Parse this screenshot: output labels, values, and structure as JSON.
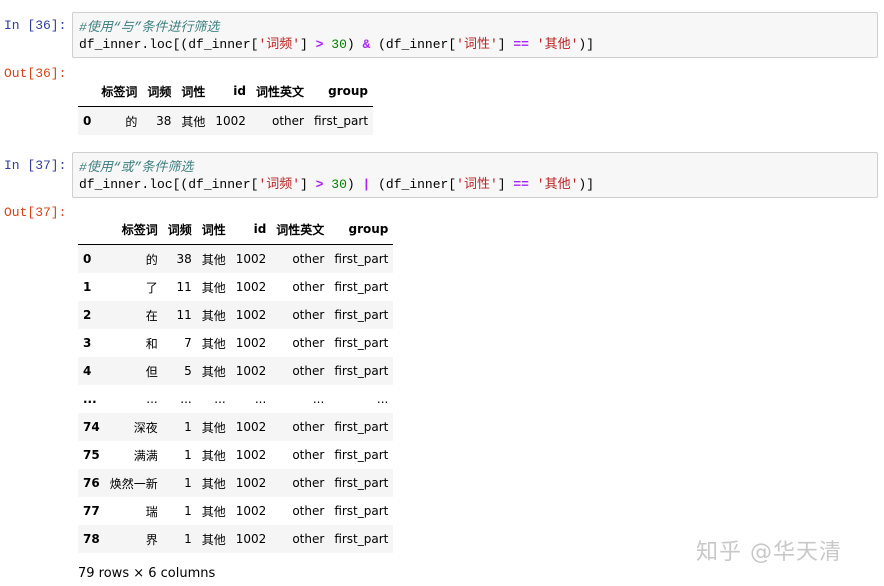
{
  "cells": [
    {
      "in_prompt": "In  [36]:",
      "out_prompt": "Out[36]:",
      "comment": "#使用“与”条件进行筛选",
      "code_parts": [
        "df_inner.loc[(df_inner[",
        "'词频'",
        "] ",
        ">",
        " ",
        "30",
        ") ",
        "&",
        " (df_inner[",
        "'词性'",
        "] ",
        "==",
        " ",
        "'其他'",
        ")]"
      ],
      "table": {
        "columns": [
          "",
          "标签词",
          "词频",
          "词性",
          "id",
          "词性英文",
          "group"
        ],
        "rows": [
          [
            "0",
            "的",
            "38",
            "其他",
            "1002",
            "other",
            "first_part"
          ]
        ]
      }
    },
    {
      "in_prompt": "In  [37]:",
      "out_prompt": "Out[37]:",
      "comment": "#使用“或”条件筛选",
      "code_parts": [
        "df_inner.loc[(df_inner[",
        "'词频'",
        "] ",
        ">",
        " ",
        "30",
        ") ",
        "|",
        " (df_inner[",
        "'词性'",
        "] ",
        "==",
        " ",
        "'其他'",
        ")]"
      ],
      "table": {
        "columns": [
          "",
          "标签词",
          "词频",
          "词性",
          "id",
          "词性英文",
          "group"
        ],
        "rows": [
          [
            "0",
            "的",
            "38",
            "其他",
            "1002",
            "other",
            "first_part"
          ],
          [
            "1",
            "了",
            "11",
            "其他",
            "1002",
            "other",
            "first_part"
          ],
          [
            "2",
            "在",
            "11",
            "其他",
            "1002",
            "other",
            "first_part"
          ],
          [
            "3",
            "和",
            "7",
            "其他",
            "1002",
            "other",
            "first_part"
          ],
          [
            "4",
            "但",
            "5",
            "其他",
            "1002",
            "other",
            "first_part"
          ],
          [
            "...",
            "...",
            "...",
            "...",
            "...",
            "...",
            "..."
          ],
          [
            "74",
            "深夜",
            "1",
            "其他",
            "1002",
            "other",
            "first_part"
          ],
          [
            "75",
            "满满",
            "1",
            "其他",
            "1002",
            "other",
            "first_part"
          ],
          [
            "76",
            "焕然一新",
            "1",
            "其他",
            "1002",
            "other",
            "first_part"
          ],
          [
            "77",
            "瑞",
            "1",
            "其他",
            "1002",
            "other",
            "first_part"
          ],
          [
            "78",
            "界",
            "1",
            "其他",
            "1002",
            "other",
            "first_part"
          ]
        ]
      },
      "footer": "79 rows × 6 columns"
    }
  ],
  "watermark": "知乎 @华天清"
}
